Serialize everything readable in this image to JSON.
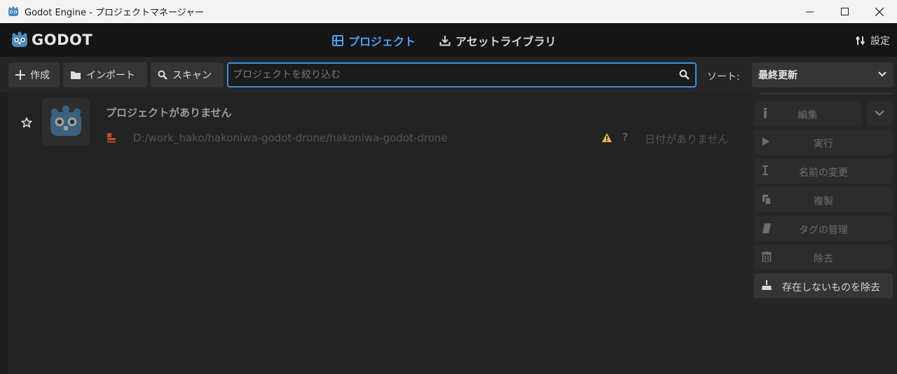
{
  "window": {
    "title": "Godot Engine - プロジェクトマネージャー"
  },
  "topbar": {
    "logo_text": "GODOT",
    "tabs": [
      {
        "label": "プロジェクト",
        "active": true
      },
      {
        "label": "アセットライブラリ",
        "active": false
      }
    ],
    "settings_label": "設定"
  },
  "toolbar": {
    "create_label": "作成",
    "import_label": "インポート",
    "scan_label": "スキャン",
    "search_placeholder": "プロジェクトを絞り込む",
    "search_value": "",
    "sort_label": "ソート:",
    "sort_selected": "最終更新"
  },
  "projects": [
    {
      "name": "プロジェクトがありません",
      "path": "D:/work_hako/hakoniwa-godot-drone/hakoniwa-godot-drone",
      "unknown_version": "?",
      "date": "日付がありません",
      "favorite": false,
      "missing": true
    }
  ],
  "side_panel": {
    "edit_label": "編集",
    "run_label": "実行",
    "rename_label": "名前の変更",
    "duplicate_label": "複製",
    "tags_label": "タグの管理",
    "remove_label": "除去",
    "clean_label": "存在しないものを除去"
  },
  "colors": {
    "accent": "#4b9ff0",
    "background": "#1f1f1f",
    "godot_blue": "#478cbf",
    "warning": "#e0b84a",
    "missing_icon": "#c24a3a"
  }
}
